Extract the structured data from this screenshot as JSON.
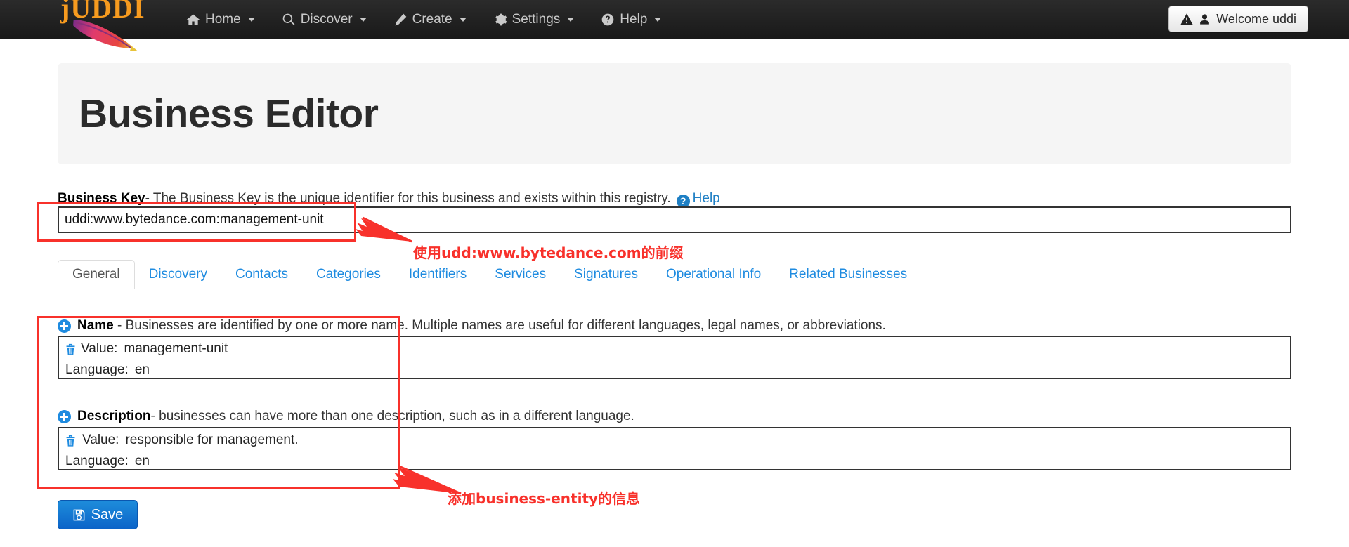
{
  "navbar": {
    "brand": "jUDDI",
    "items": [
      {
        "label": "Home",
        "icon": "home-icon",
        "caret": true
      },
      {
        "label": "Discover",
        "icon": "search-icon",
        "caret": true
      },
      {
        "label": "Create",
        "icon": "pencil-icon",
        "caret": true
      },
      {
        "label": "Settings",
        "icon": "gear-icon",
        "caret": true
      },
      {
        "label": "Help",
        "icon": "question-circle-icon",
        "caret": true
      }
    ],
    "welcome_label": "Welcome uddi",
    "welcome_icons": [
      "warning-triangle-icon",
      "user-icon"
    ]
  },
  "header": {
    "title": "Business Editor"
  },
  "business_key": {
    "label": "Business Key",
    "description": "- The Business Key is the unique identifier for this business and exists within this registry.",
    "help_label": "Help",
    "help_icon": "question-circle-icon",
    "value": "uddi:www.bytedance.com:management-unit",
    "placeholder": ""
  },
  "tabs": [
    {
      "label": "General",
      "active": true
    },
    {
      "label": "Discovery",
      "active": false
    },
    {
      "label": "Contacts",
      "active": false
    },
    {
      "label": "Categories",
      "active": false
    },
    {
      "label": "Identifiers",
      "active": false
    },
    {
      "label": "Services",
      "active": false
    },
    {
      "label": "Signatures",
      "active": false
    },
    {
      "label": "Operational Info",
      "active": false
    },
    {
      "label": "Related Businesses",
      "active": false
    }
  ],
  "sections": {
    "name": {
      "title": "Name",
      "description": " - Businesses are identified by one or more name. Multiple names are useful for different languages, legal names, or abbreviations.",
      "add_icon": "plus-circle-icon",
      "delete_icon": "trash-icon",
      "value_label": "Value:",
      "value": "management-unit",
      "language_label": "Language:",
      "language": "en"
    },
    "description": {
      "title": "Description",
      "description": "- businesses can have more than one description, such as in a different language.",
      "add_icon": "plus-circle-icon",
      "delete_icon": "trash-icon",
      "value_label": "Value:",
      "value": "responsible for management.",
      "language_label": "Language:",
      "language": "en"
    }
  },
  "save_button": {
    "label": "Save",
    "icon": "floppy-disk-icon"
  },
  "annotations": {
    "accent_color": "#f8312b",
    "key_note": "使用udd:www.bytedance.com的前缀",
    "entity_note": "添加business-entity的信息"
  }
}
